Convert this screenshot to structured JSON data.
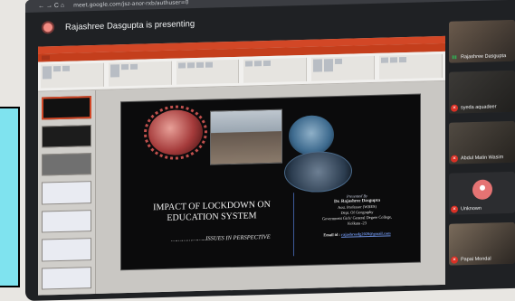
{
  "browser": {
    "nav": "← → C  ⌂",
    "url": "meet.google.com/jsz-anor-rxb/authuser=0"
  },
  "meet": {
    "presenting_text": "Rajashree Dasgupta is presenting"
  },
  "slide": {
    "title_line1": "IMPACT OF LOCKDOWN ON",
    "title_line2": "EDUCATION SYSTEM",
    "subtitle": "………………..ISSUES IN PERSPECTIVE",
    "presented_by": "Presented By",
    "presenter_name": "Dr. Rajashree Dasgupta",
    "presenter_role": "Asst. Professor (WBES)",
    "presenter_dept": "Dept. Of Geography",
    "presenter_college": "Government Girls' General Degree College,",
    "presenter_city": "Kolkata -23",
    "email_label": "Email id :",
    "email_value": "rajashreedg2020@gmail.com"
  },
  "participants": [
    {
      "name": "Rajashree Dasgupta",
      "mic": "on"
    },
    {
      "name": "syeda aquadeer",
      "mic": "off"
    },
    {
      "name": "Abdul Matin Wasim",
      "mic": "off"
    },
    {
      "name": "Unknown",
      "mic": "off"
    },
    {
      "name": "Papai Mondal",
      "mic": "off"
    }
  ]
}
